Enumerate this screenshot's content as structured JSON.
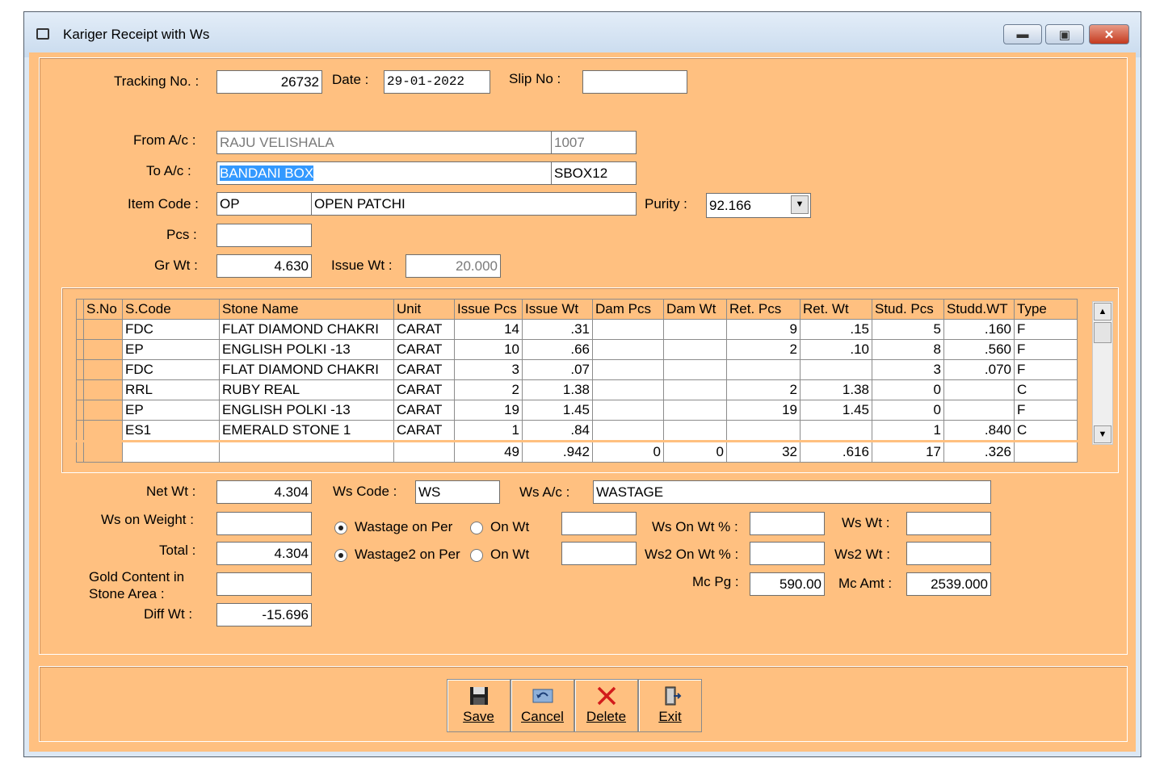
{
  "window": {
    "title": "Kariger Receipt with Ws"
  },
  "header": {
    "tracking_label": "Tracking No. :",
    "tracking_value": "26732",
    "date_label": "Date :",
    "date_value": "29-01-2022",
    "slip_label": "Slip No :",
    "slip_value": ""
  },
  "accounts": {
    "from_label": "From A/c :",
    "from_name": "RAJU VELISHALA",
    "from_code": "1007",
    "to_label": "To A/c :",
    "to_name": "BANDANI BOX",
    "to_code": "SBOX12",
    "item_label": "Item Code :",
    "item_code": "OP",
    "item_name": "OPEN PATCHI",
    "purity_label": "Purity :",
    "purity_value": "92.166",
    "pcs_label": "Pcs :",
    "pcs_value": "",
    "grwt_label": "Gr Wt :",
    "grwt_value": "4.630",
    "issuewt_label": "Issue Wt :",
    "issuewt_value": "20.000"
  },
  "grid": {
    "columns": [
      "S.No",
      "S.Code",
      "Stone Name",
      "Unit",
      "Issue Pcs",
      "Issue Wt",
      "Dam Pcs",
      "Dam Wt",
      "Ret. Pcs",
      "Ret. Wt",
      "Stud. Pcs",
      "Studd.WT",
      "Type"
    ],
    "rows": [
      [
        "",
        "FDC",
        "FLAT DIAMOND CHAKRI",
        "CARAT",
        "14",
        ".31",
        "",
        "",
        "9",
        ".15",
        "5",
        ".160",
        "F"
      ],
      [
        "",
        "EP",
        "ENGLISH POLKI -13",
        "CARAT",
        "10",
        ".66",
        "",
        "",
        "2",
        ".10",
        "8",
        ".560",
        "F"
      ],
      [
        "",
        "FDC",
        "FLAT DIAMOND CHAKRI",
        "CARAT",
        "3",
        ".07",
        "",
        "",
        "",
        "",
        "3",
        ".070",
        "F"
      ],
      [
        "",
        "RRL",
        "RUBY REAL",
        "CARAT",
        "2",
        "1.38",
        "",
        "",
        "2",
        "1.38",
        "0",
        "",
        "C"
      ],
      [
        "",
        "EP",
        "ENGLISH POLKI -13",
        "CARAT",
        "19",
        "1.45",
        "",
        "",
        "19",
        "1.45",
        "0",
        "",
        "F"
      ],
      [
        "",
        "ES1",
        "EMERALD STONE 1",
        "CARAT",
        "1",
        ".84",
        "",
        "",
        "",
        "",
        "1",
        ".840",
        "C"
      ]
    ],
    "totals": [
      "",
      "",
      "",
      "",
      "49",
      ".942",
      "0",
      "0",
      "32",
      ".616",
      "17",
      ".326",
      ""
    ]
  },
  "bottom": {
    "netwt_label": "Net Wt :",
    "netwt_value": "4.304",
    "wscode_label": "Ws Code :",
    "wscode_value": "WS",
    "wsac_label": "Ws A/c :",
    "wsac_value": "WASTAGE",
    "wsonweight_label": "Ws on Weight :",
    "wsonweight_value": "",
    "radio1_label": "Wastage on Per",
    "radio1_alt": "On Wt",
    "radio1_field": "",
    "wsonwtpct_label": "Ws On Wt % :",
    "wsonwtpct_value": "",
    "wswt_label": "Ws Wt :",
    "wswt_value": "",
    "total_label": "Total :",
    "total_value": "4.304",
    "radio2_label": "Wastage2 on Per",
    "radio2_alt": "On Wt",
    "radio2_field": "",
    "ws2onwtpct_label": "Ws2 On Wt % :",
    "ws2onwtpct_value": "",
    "ws2wt_label": "Ws2 Wt :",
    "ws2wt_value": "",
    "gold_label_1": "Gold Content in",
    "gold_label_2": "Stone Area :",
    "gold_value": "",
    "mcpg_label": "Mc Pg :",
    "mcpg_value": "590.00",
    "mcamt_label": "Mc Amt :",
    "mcamt_value": "2539.000",
    "diffwt_label": "Diff Wt :",
    "diffwt_value": "-15.696"
  },
  "buttons": {
    "save": "Save",
    "cancel": "Cancel",
    "delete": "Delete",
    "exit": "Exit"
  }
}
